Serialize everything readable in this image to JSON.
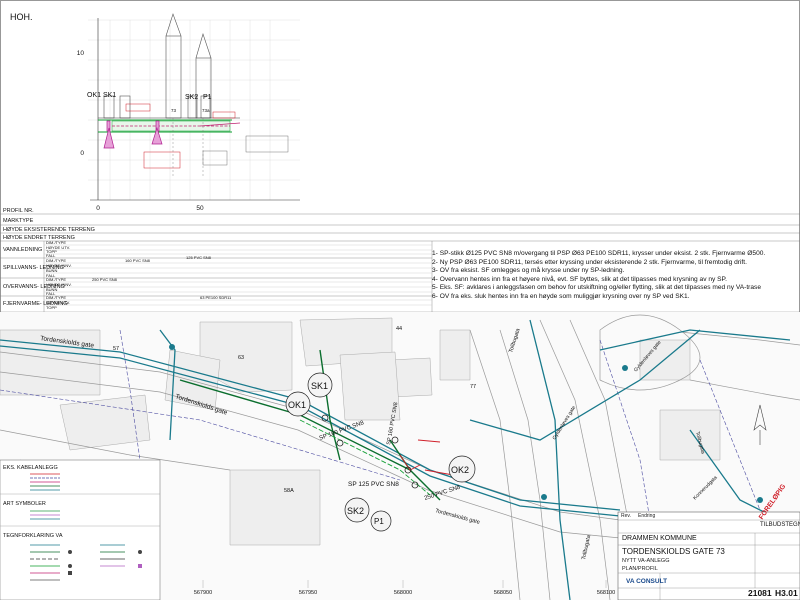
{
  "profile": {
    "title": "HOH.",
    "y_ticks": [
      "10",
      "0"
    ],
    "x_ticks": [
      "0",
      "50"
    ],
    "point_labels": [
      "OK1",
      "SK1",
      "SK2",
      "P1"
    ],
    "small_labels": [
      "73",
      "73a"
    ]
  },
  "table": {
    "rows": [
      "PROFIL NR.",
      "MARKTYPE",
      "HØYDE EKSISTERENDE TERRENG",
      "HØYDE ENDRET TERRENG",
      "VANNLEDNING",
      "SPILLVANNS-\nLEDNING",
      "OVERVANNS-\nLEDNING",
      "FJERNVARME-\nLEDNING"
    ],
    "sub_vann": [
      "DIM./TYPE",
      "HØYDE UTV.",
      "TOPP",
      "FALL"
    ],
    "sub_spill": [
      "DIM./TYPE",
      "HØYDE INNV.",
      "BUNN",
      "FALL"
    ],
    "sub_over": [
      "DIM./TYPE",
      "HØYDE INNV.",
      "BUNN",
      "FALL"
    ],
    "sub_fjern": [
      "DIM./TYPE",
      "HØYDE UTV.",
      "TOPP"
    ],
    "pipe_labels": [
      "160 PVC SN8",
      "125 PVC SN8",
      "250 PVC SN8",
      "63 PE100 SDR11"
    ]
  },
  "notes": [
    "1- SP-stikk Ø125 PVC SN8 m/overgang til PSP Ø63 PE100 SDR11, krysser under eksist. 2 stk. Fjernvarme Ø500.",
    "2- Ny PSP Ø63 PE100 SDR11, tersés etter kryssing under eksisterende 2 stk. Fjernvarme, til fremtodig drift.",
    "3- OV fra eksist. SF omlegges og må krysse under ny SP-ledning.",
    "4- Overvann hentes inn fra et høyere nivå, evt. SF byttes, slik at det tilpasses med krysning av ny SP.",
    "5- Eks. SF: avklares i anleggsfasen om behov for utskiftning og/eller flytting, slik at det tilpasses med ny VA-trase",
    "6- OV fra eks. sluk hentes inn fra en høyde som muliggjør krysning over ny SP ved SK1."
  ],
  "map": {
    "streets": [
      "Tordenskiolds gate",
      "Tordenskiolds gate",
      "Tordenskiolds gate",
      "Tollbugata",
      "Tollbugata",
      "Tollbugata",
      "Gyldenløves gate",
      "Gyldenløves gate",
      "Konnerudgata"
    ],
    "manholes": [
      "SK1",
      "OK1",
      "OK2",
      "SK2",
      "P1"
    ],
    "pipe_labels": [
      "SP 160 PVC SN8",
      "SP 125 PVC SN8",
      "250 PVC SN8",
      "SP 160 PVC SN8"
    ],
    "plot_numbers": [
      "57",
      "63",
      "44",
      "58A",
      "77"
    ],
    "coords": [
      "567900",
      "567950",
      "568000",
      "568050",
      "568100"
    ]
  },
  "legend": {
    "sections": [
      "EKS. KABELANLEGG",
      "ART SYMBOLER",
      "TEGNFORKLARING VA"
    ]
  },
  "title_block": {
    "revision_header": [
      "Rev.",
      "Endring"
    ],
    "status": "FORELØPIG",
    "doc_type": "TILBUDSTEGNING",
    "client": "DRAMMEN KOMMUNE",
    "project": "TORDENSKIOLDS GATE 73",
    "subtitle": "NYTT VA-ANLEGG",
    "drawing_type": "PLAN/PROFIL",
    "company": "VA CONSULT",
    "project_no": "21081",
    "drawing_no": "H3.01"
  },
  "colors": {
    "water": "#1a7a8c",
    "sewer": "#0b6e2e",
    "status": "#d0202a",
    "cable": "#4a4aa0"
  }
}
